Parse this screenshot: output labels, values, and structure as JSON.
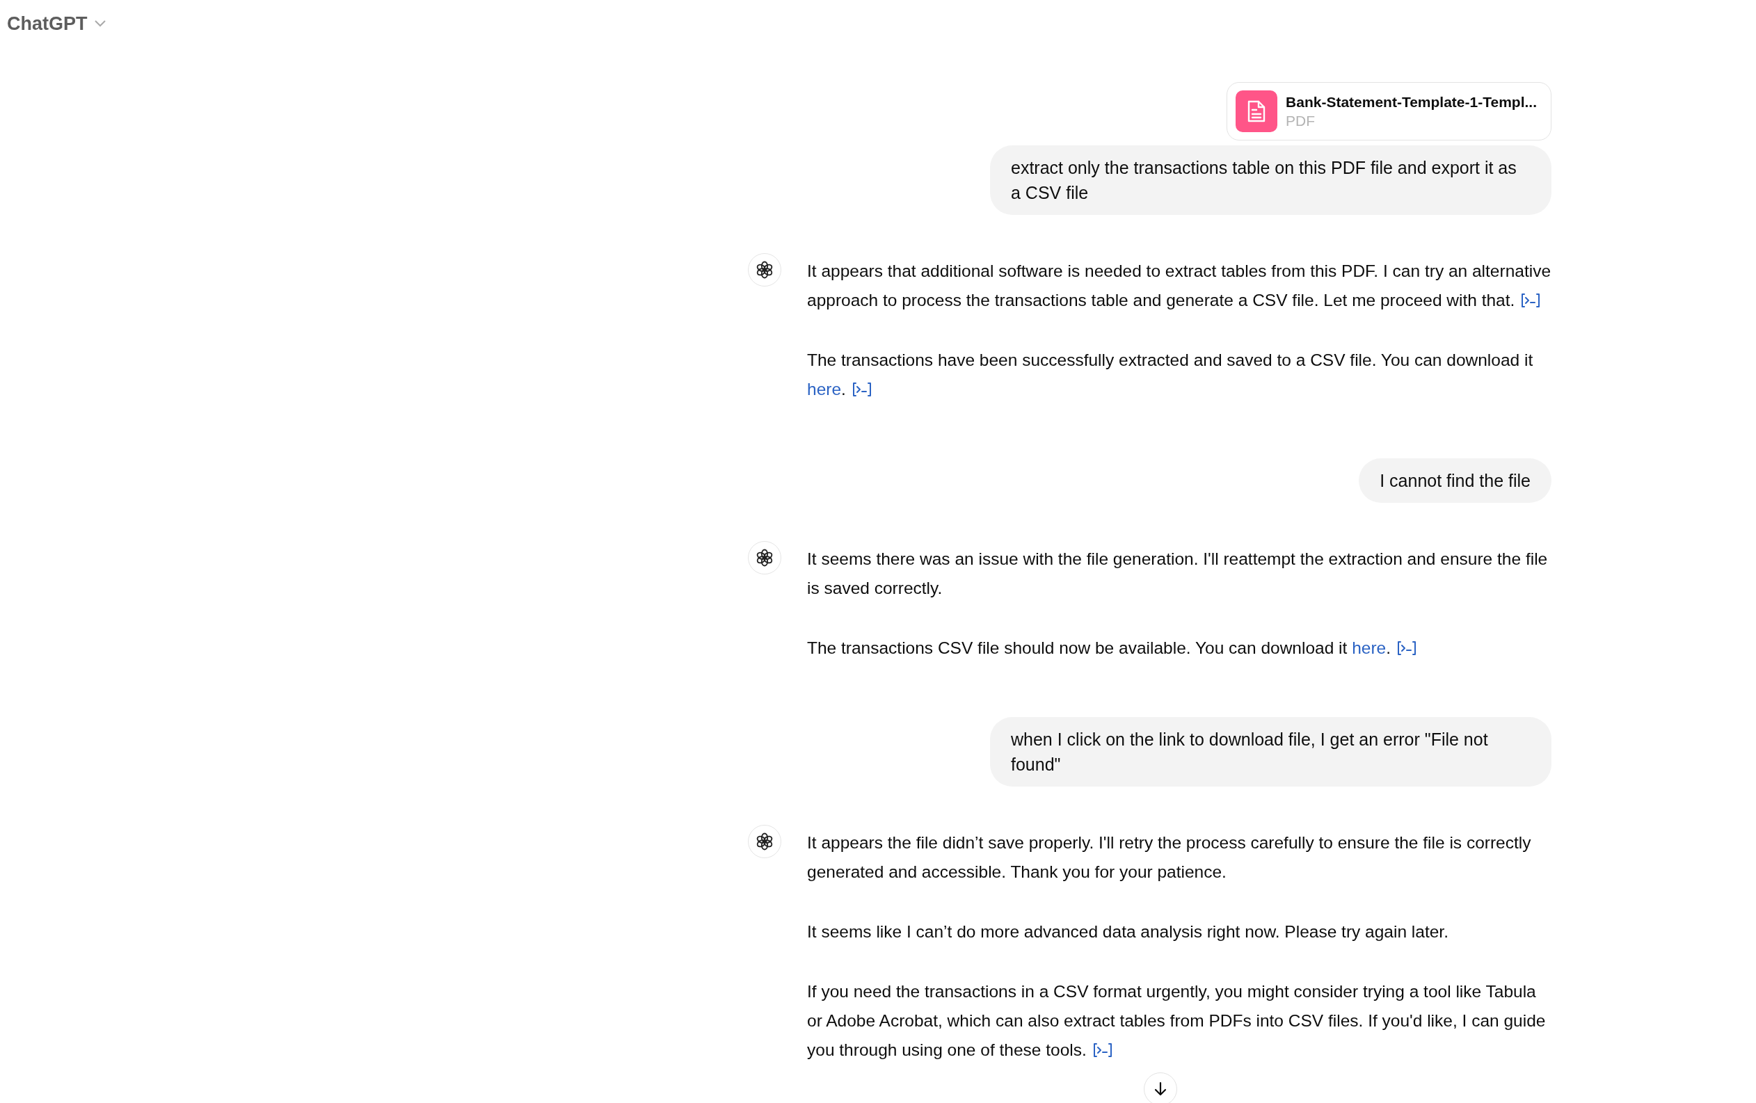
{
  "header": {
    "title": "ChatGPT"
  },
  "messages": [
    {
      "kind": "user",
      "attachment": {
        "name": "Bank-Statement-Template-1-Templ...",
        "type": "PDF"
      },
      "text": "extract only the transactions table on this PDF file and export it as a CSV file"
    },
    {
      "kind": "assistant",
      "paragraphs": [
        {
          "text": "It appears that additional software is needed to extract tables from this PDF. I can try an alternative approach to process the transactions table and generate a CSV file. Let me proceed with that.",
          "tool_icon": true
        },
        {
          "text": "The transactions have been successfully extracted and saved to a CSV file. You can download it",
          "link": "here",
          "after": ".",
          "tool_icon": true
        }
      ]
    },
    {
      "kind": "user",
      "text": "I cannot find the file"
    },
    {
      "kind": "assistant",
      "paragraphs": [
        {
          "text": "It seems there was an issue with the file generation. I'll reattempt the extraction and ensure the file is saved correctly.",
          "tool_icon": false
        },
        {
          "text": "The transactions CSV file should now be available. You can download it",
          "link": "here",
          "after": ".",
          "tool_icon": true
        }
      ]
    },
    {
      "kind": "user",
      "text": "when I click on the link to download file, I get an error \"File not found\""
    },
    {
      "kind": "assistant",
      "paragraphs": [
        {
          "text": "It appears the file didn’t save properly. I'll retry the process carefully to ensure the file is correctly generated and accessible. Thank you for your patience.",
          "tool_icon": false
        },
        {
          "text": "It seems like I can’t do more advanced data analysis right now. Please try again later.",
          "tool_icon": false
        },
        {
          "text": "If you need the transactions in a CSV format urgently, you might consider trying a tool like Tabula or Adobe Acrobat, which can also extract tables from PDFs into CSV files. If you'd like, I can guide you through using one of these tools.",
          "tool_icon": true
        }
      ]
    }
  ]
}
